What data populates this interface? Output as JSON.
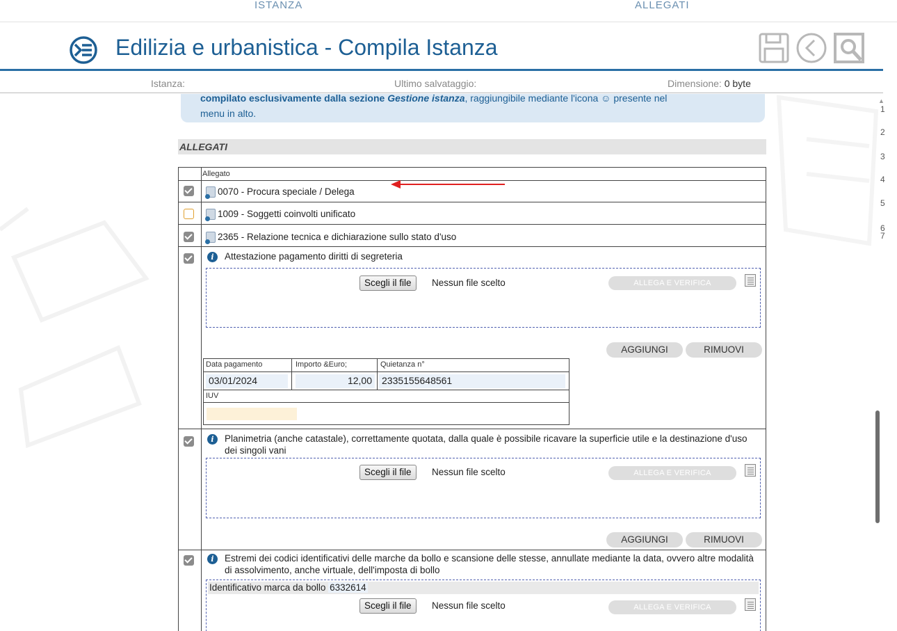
{
  "top_tabs": {
    "istanza": "ISTANZA",
    "allegati": "ALLEGATI"
  },
  "header": {
    "title": "Edilizia e urbanistica - Compila Istanza",
    "logo_icon": "edilizia-logo-icon",
    "tools": [
      "save-icon",
      "back-icon",
      "exit-icon"
    ]
  },
  "infobar": {
    "istanza_label": "Istanza:",
    "salvataggio_label": "Ultimo salvataggio:",
    "dimensione_label": "Dimensione:",
    "dimensione_value": "0 byte"
  },
  "notice": {
    "line1_bold": "compilato esclusivamente dalla sezione",
    "line1_bold_italic": "Gestione istanza",
    "line1_rest": ", raggiungibile mediante l'icona",
    "line1_end": " presente nel",
    "line2": "menu in alto."
  },
  "section_title": "ALLEGATI",
  "scroll_numbers": [
    "1",
    "2",
    "3",
    "4",
    "5",
    "6",
    "7"
  ],
  "table": {
    "header": "Allegato",
    "simple_rows": [
      {
        "checked": true,
        "label": "0070 - Procura speciale / Delega"
      },
      {
        "checked": false,
        "label": "1009 - Soggetti coinvolti unificato"
      },
      {
        "checked": true,
        "label": "2365 - Relazione tecnica e dichiarazione sullo stato d'uso"
      }
    ],
    "items": [
      {
        "checked": true,
        "text": "Attestazione pagamento diritti di segreteria"
      },
      {
        "checked": true,
        "text": "Planimetria (anche catastale), correttamente quotata, dalla quale è possibile ricavare la superficie utile e la destinazione d'uso dei singoli vani"
      },
      {
        "checked": true,
        "text": "Estremi dei codici identificativi delle marche da bollo e scansione delle stesse, annullate mediante la data, ovvero altre modalità  di assolvimento, anche virtuale, dell'imposta di bollo"
      }
    ],
    "upload": {
      "choose_label": "Scegli il file",
      "no_file_label": "Nessun file scelto",
      "allega_label": "ALLEGA E VERIFICA"
    },
    "buttons": {
      "aggiungi": "AGGIUNGI",
      "rimuovi": "RIMUOVI"
    },
    "payment": {
      "data_label": "Data pagamento",
      "importo_label": "Importo &Euro;",
      "quietanza_label": "Quietanza n°",
      "iuv_label": "IUV",
      "data_value": "03/01/2024",
      "importo_value": "12,00",
      "quietanza_value": "2335155648561",
      "iuv_value": ""
    },
    "marca": {
      "label": "Identificativo marca da bollo",
      "value": "6332614"
    }
  },
  "colors": {
    "accent": "#1d5f94",
    "arrow": "#e02020",
    "notice_bg": "#dbe8f4"
  }
}
